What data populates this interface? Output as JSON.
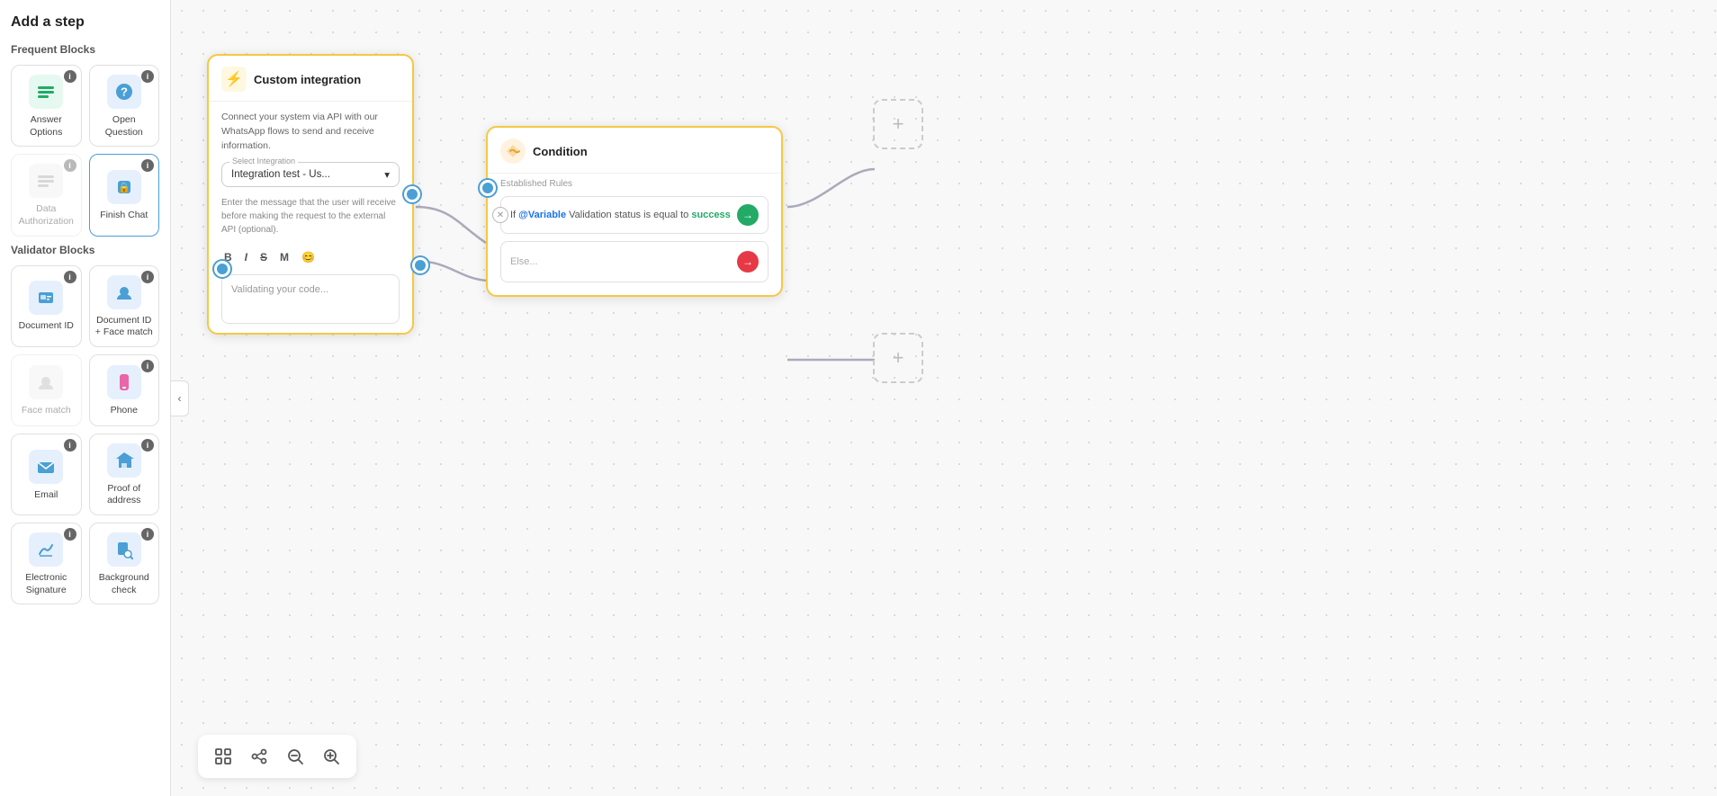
{
  "sidebar": {
    "title": "Add a step",
    "frequent_section": "Frequent Blocks",
    "validator_section": "Validator Blocks",
    "frequent_blocks": [
      {
        "id": "answer-options",
        "label": "Answer\nOptions",
        "icon": "☰",
        "icon_bg": "icon-green",
        "has_info": true,
        "disabled": false
      },
      {
        "id": "open-question",
        "label": "Open\nQuestion",
        "icon": "?",
        "icon_bg": "icon-blue",
        "has_info": true,
        "disabled": false
      },
      {
        "id": "data-authorization",
        "label": "Data\nAuthorization",
        "icon": "≡",
        "icon_bg": "icon-gray",
        "has_info": true,
        "disabled": true
      },
      {
        "id": "finish-chat",
        "label": "Finish\nChat",
        "icon": "🔒",
        "icon_bg": "icon-blue",
        "has_info": true,
        "disabled": false
      }
    ],
    "validator_blocks": [
      {
        "id": "document-id",
        "label": "Document\nID",
        "icon": "🪪",
        "icon_bg": "icon-blue",
        "has_info": true,
        "disabled": false
      },
      {
        "id": "document-id-face",
        "label": "Document\nID + Face\nmatch",
        "icon": "👤",
        "icon_bg": "icon-blue",
        "has_info": true,
        "disabled": false
      },
      {
        "id": "face-match",
        "label": "Face\nmatch",
        "icon": "😊",
        "icon_bg": "icon-gray",
        "has_info": false,
        "disabled": true
      },
      {
        "id": "phone",
        "label": "Phone",
        "icon": "📱",
        "icon_bg": "icon-blue",
        "has_info": true,
        "disabled": false
      },
      {
        "id": "email",
        "label": "Email",
        "icon": "✉",
        "icon_bg": "icon-blue",
        "has_info": true,
        "disabled": false
      },
      {
        "id": "proof-of-address",
        "label": "Proof of\naddress",
        "icon": "🏠",
        "icon_bg": "icon-blue",
        "has_info": true,
        "disabled": false
      },
      {
        "id": "electronic-signature",
        "label": "Electronic\nSignature",
        "icon": "✍",
        "icon_bg": "icon-blue",
        "has_info": true,
        "disabled": false
      },
      {
        "id": "background-check",
        "label": "Background\ncheck",
        "icon": "🔍",
        "icon_bg": "icon-blue",
        "has_info": true,
        "disabled": false
      }
    ]
  },
  "custom_integration_card": {
    "title": "Custom integration",
    "icon": "⚡",
    "description": "Connect your system via API with our WhatsApp flows to send and receive information.",
    "select_label": "Select Integration",
    "select_value": "Integration test - Us...",
    "hint": "Enter the message that the user will receive before making the request to the external API (optional).",
    "toolbar_buttons": [
      "B",
      "I",
      "S",
      "M",
      "😊"
    ],
    "placeholder": "Validating your code..."
  },
  "condition_card": {
    "title": "Condition",
    "icon": "🔀",
    "section_label": "Established Rules",
    "rule": {
      "prefix": "If",
      "variable": "@Variable",
      "variable_name": "Validation status",
      "operator": "is equal to",
      "value": "success"
    },
    "else_label": "Else..."
  },
  "canvas_toolbar": {
    "fit_label": "fit-screen",
    "share_label": "share",
    "zoom_out_label": "zoom-out",
    "zoom_in_label": "zoom-in"
  },
  "colors": {
    "accent_yellow": "#f5c842",
    "accent_blue": "#4a9fd4",
    "accent_green": "#22aa66",
    "accent_red": "#e63946"
  }
}
